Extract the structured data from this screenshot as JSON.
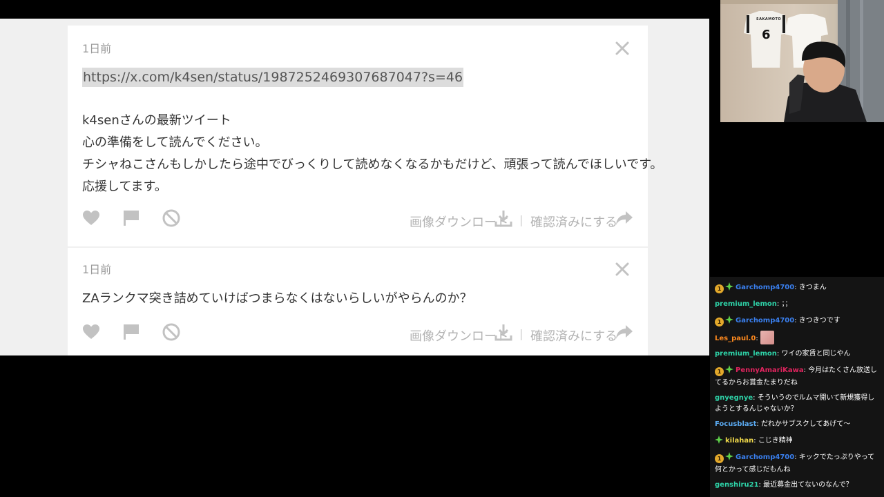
{
  "page": {
    "posts": [
      {
        "time": "1日前",
        "url": "https://x.com/k4sen/status/1987252469307687047?s=46",
        "lines": [
          "k4senさんの最新ツイート",
          "心の準備をして読んでください。",
          "チシャねこさんもしかしたら途中でびっくりして読めなくなるかもだけど、頑張って読んでほしいです。",
          "応援してます。"
        ],
        "download_label": "画像ダウンロード",
        "separator": "|",
        "confirm_label": "確認済みにする"
      },
      {
        "time": "1日前",
        "lines": [
          "ZAランクマ突き詰めていけばつまらなくはないらしいがやらんのか？"
        ],
        "download_label": "画像ダウンロード",
        "separator": "|",
        "confirm_label": "確認済みにする"
      }
    ],
    "icons": [
      "close-icon",
      "heart-icon",
      "flag-icon",
      "block-icon",
      "download-icon",
      "share-icon"
    ]
  },
  "webcam": {
    "jersey_text": "SAKAMOTO",
    "jersey_number": "6"
  },
  "chat": {
    "messages": [
      {
        "badges": [
          "sub",
          "gem"
        ],
        "user": "Garchomp4700",
        "color": "#3a80f0",
        "text": "きつまん"
      },
      {
        "badges": [],
        "user": "premium_lemon",
        "color": "#2ed3a8",
        "text": "；；"
      },
      {
        "badges": [
          "sub",
          "gem"
        ],
        "user": "Garchomp4700",
        "color": "#3a80f0",
        "text": "きつきつです"
      },
      {
        "badges": [],
        "user": "Les_paul.0",
        "color": "#ff8a1e",
        "text": "",
        "emote": "pink-face-emote"
      },
      {
        "badges": [],
        "user": "premium_lemon",
        "color": "#2ed3a8",
        "text": "ワイの家賃と同じやん"
      },
      {
        "badges": [
          "sub",
          "gem"
        ],
        "user": "PennyAmariKawa",
        "color": "#e0245e",
        "text": "今月はたくさん放送してるからお賞金たまりだね"
      },
      {
        "badges": [],
        "user": "gnyegnye",
        "color": "#2ed3a8",
        "text": "そういうのでルムマ開いて新規獲得しようとするんじゃないか？"
      },
      {
        "badges": [],
        "user": "Focusblast",
        "color": "#5aa9f0",
        "text": "だれかサブスクしてあげて〜"
      },
      {
        "badges": [
          "gem"
        ],
        "user": "kilahan",
        "color": "#f0d94a",
        "text": "こじき精神"
      },
      {
        "badges": [
          "sub",
          "gem"
        ],
        "user": "Garchomp4700",
        "color": "#3a80f0",
        "text": "キックでたっぷりやって何とかって感じだもんね"
      },
      {
        "badges": [],
        "user": "genshiru21",
        "color": "#2ed3a8",
        "text": "最近募金出てないのなんで？"
      }
    ],
    "sub_badge_text": "1"
  },
  "colors": {
    "page_bg": "#f0f0f0",
    "card_bg": "#ffffff",
    "chat_bg": "#141414",
    "icon_gray": "#c2c2c2",
    "url_highlight": "#dcdcdc"
  }
}
